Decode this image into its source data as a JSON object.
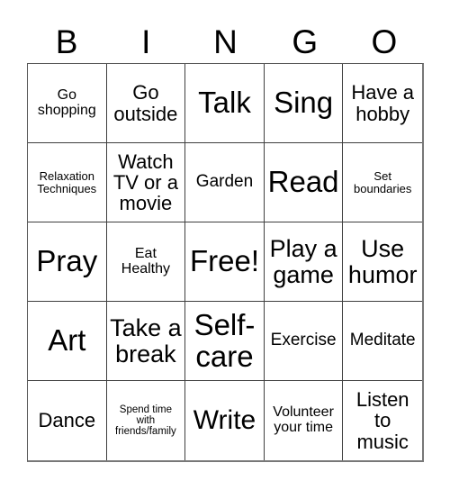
{
  "header": {
    "letters": [
      "B",
      "I",
      "N",
      "G",
      "O"
    ]
  },
  "grid": {
    "rows": [
      [
        {
          "text": "Go shopping",
          "size": "fs-xs"
        },
        {
          "text": "Go outside",
          "size": "fs-m"
        },
        {
          "text": "Talk",
          "size": "fs-xxl"
        },
        {
          "text": "Sing",
          "size": "fs-xxl"
        },
        {
          "text": "Have a hobby",
          "size": "fs-m"
        }
      ],
      [
        {
          "text": "Relaxation Techniques",
          "size": "fs-xxs"
        },
        {
          "text": "Watch TV or a movie",
          "size": "fs-m"
        },
        {
          "text": "Garden",
          "size": "fs-s"
        },
        {
          "text": "Read",
          "size": "fs-xxl"
        },
        {
          "text": "Set boundaries",
          "size": "fs-xxs"
        }
      ],
      [
        {
          "text": "Pray",
          "size": "fs-xxl"
        },
        {
          "text": "Eat Healthy",
          "size": "fs-xs"
        },
        {
          "text": "Free!",
          "size": "fs-xxl"
        },
        {
          "text": "Play a game",
          "size": "fs-l"
        },
        {
          "text": "Use humor",
          "size": "fs-l"
        }
      ],
      [
        {
          "text": "Art",
          "size": "fs-xxl"
        },
        {
          "text": "Take a break",
          "size": "fs-l"
        },
        {
          "text": "Self-care",
          "size": "fs-xxl"
        },
        {
          "text": "Exercise",
          "size": "fs-s"
        },
        {
          "text": "Meditate",
          "size": "fs-s"
        }
      ],
      [
        {
          "text": "Dance",
          "size": "fs-m"
        },
        {
          "text": "Spend time with friends/family",
          "size": "fs-tiny"
        },
        {
          "text": "Write",
          "size": "fs-xl"
        },
        {
          "text": "Volunteer your time",
          "size": "fs-xs"
        },
        {
          "text": "Listen to music",
          "size": "fs-m"
        }
      ]
    ]
  }
}
